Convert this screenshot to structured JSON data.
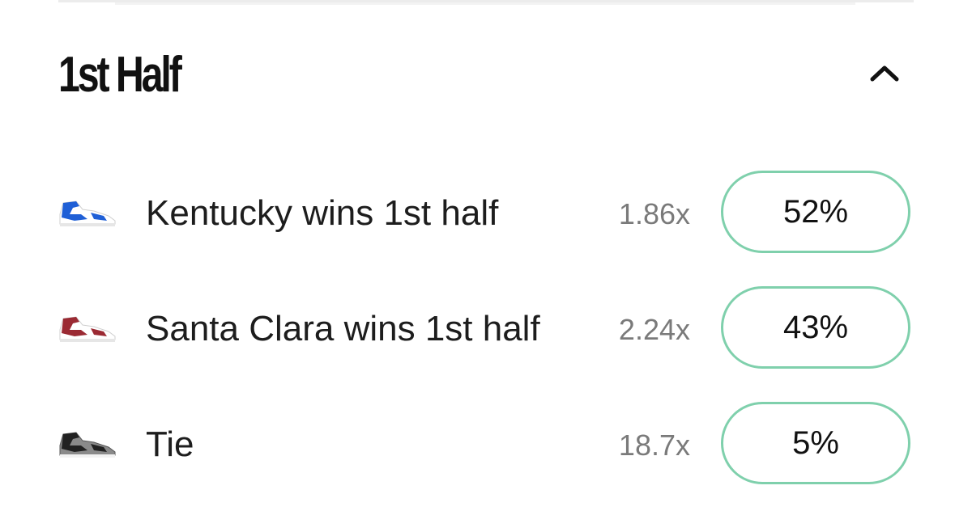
{
  "section": {
    "title": "1st Half",
    "collapse_icon": "chevron-up-icon"
  },
  "outcomes": [
    {
      "label": "Kentucky wins 1st half",
      "multiplier": "1.86x",
      "percent": "52%",
      "icon": "sneaker-blue-icon",
      "colors": {
        "main": "#1f5fd6",
        "accent": "#ffffff"
      }
    },
    {
      "label": "Santa Clara wins 1st half",
      "multiplier": "2.24x",
      "percent": "43%",
      "icon": "sneaker-red-icon",
      "colors": {
        "main": "#9b2a33",
        "accent": "#ffffff"
      }
    },
    {
      "label": "Tie",
      "multiplier": "18.7x",
      "percent": "5%",
      "icon": "sneaker-gray-icon",
      "colors": {
        "main": "#8a8a8a",
        "accent": "#222222"
      }
    }
  ],
  "colors": {
    "button_border": "#7fd0ac",
    "text_primary": "#111111",
    "text_secondary": "#7a7a7a"
  }
}
